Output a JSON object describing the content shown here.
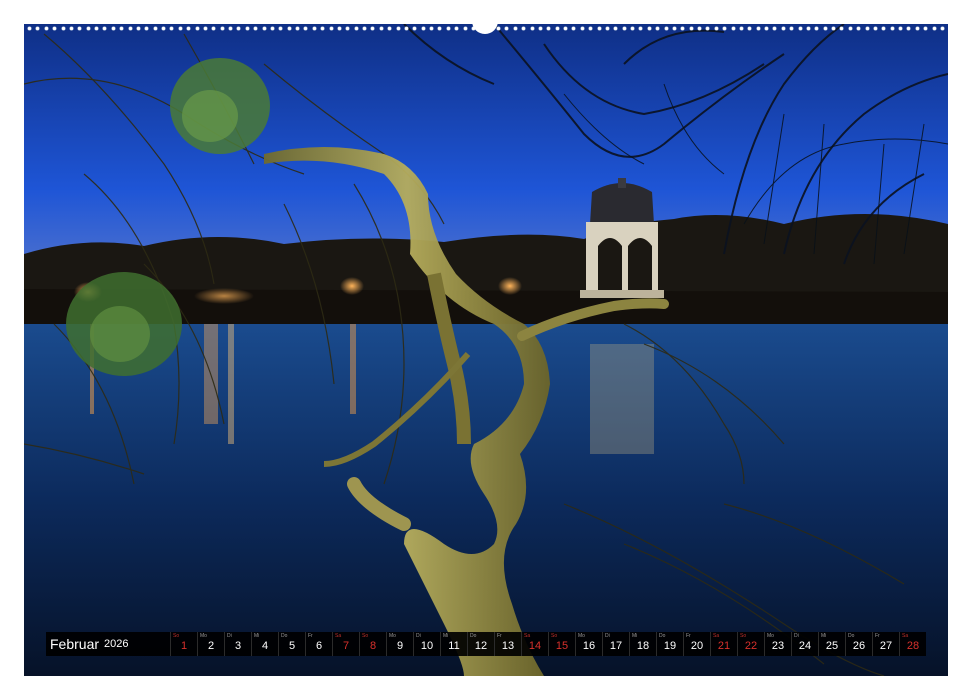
{
  "calendar": {
    "month": "Februar",
    "year": "2026",
    "days": [
      {
        "num": "1",
        "wd": "So",
        "weekend": true
      },
      {
        "num": "2",
        "wd": "Mo",
        "weekend": false
      },
      {
        "num": "3",
        "wd": "Di",
        "weekend": false
      },
      {
        "num": "4",
        "wd": "Mi",
        "weekend": false
      },
      {
        "num": "5",
        "wd": "Do",
        "weekend": false
      },
      {
        "num": "6",
        "wd": "Fr",
        "weekend": false
      },
      {
        "num": "7",
        "wd": "Sa",
        "weekend": true
      },
      {
        "num": "8",
        "wd": "So",
        "weekend": true
      },
      {
        "num": "9",
        "wd": "Mo",
        "weekend": false
      },
      {
        "num": "10",
        "wd": "Di",
        "weekend": false
      },
      {
        "num": "11",
        "wd": "Mi",
        "weekend": false
      },
      {
        "num": "12",
        "wd": "Do",
        "weekend": false
      },
      {
        "num": "13",
        "wd": "Fr",
        "weekend": false
      },
      {
        "num": "14",
        "wd": "Sa",
        "weekend": true
      },
      {
        "num": "15",
        "wd": "So",
        "weekend": true
      },
      {
        "num": "16",
        "wd": "Mo",
        "weekend": false
      },
      {
        "num": "17",
        "wd": "Di",
        "weekend": false
      },
      {
        "num": "18",
        "wd": "Mi",
        "weekend": false
      },
      {
        "num": "19",
        "wd": "Do",
        "weekend": false
      },
      {
        "num": "20",
        "wd": "Fr",
        "weekend": false
      },
      {
        "num": "21",
        "wd": "Sa",
        "weekend": true
      },
      {
        "num": "22",
        "wd": "So",
        "weekend": true
      },
      {
        "num": "23",
        "wd": "Mo",
        "weekend": false
      },
      {
        "num": "24",
        "wd": "Di",
        "weekend": false
      },
      {
        "num": "25",
        "wd": "Mi",
        "weekend": false
      },
      {
        "num": "26",
        "wd": "Do",
        "weekend": false
      },
      {
        "num": "27",
        "wd": "Fr",
        "weekend": false
      },
      {
        "num": "28",
        "wd": "Sa",
        "weekend": true
      }
    ]
  },
  "colors": {
    "weekend": "#d8312c",
    "strip_background": "#000000",
    "sky": "#1a49c7",
    "water": "#0c2a5c"
  }
}
